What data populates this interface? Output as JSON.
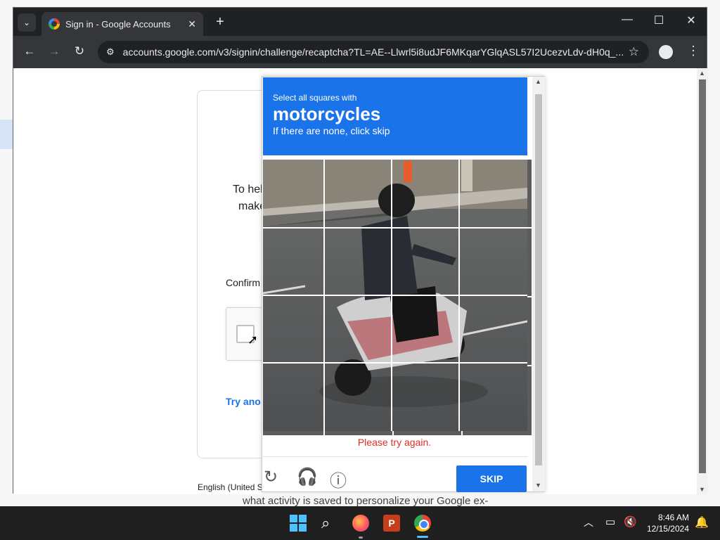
{
  "browser": {
    "tab_title": "Sign in - Google Accounts",
    "url": "accounts.google.com/v3/signin/challenge/recaptcha?TL=AE--Llwrl5i8udJF6MKqarYGlqASL57I2UcezvLdv-dH0q_...",
    "new_tab": "+",
    "tab_close": "✕"
  },
  "signin": {
    "help_line1": "To hel",
    "help_line2": "make",
    "confirm": "Confirm",
    "try_another": "Try ano",
    "language": "English (United S"
  },
  "desktop": {
    "bottom_text": "what activity is saved to personalize your Google ex-"
  },
  "challenge": {
    "instruction": "Select all squares with",
    "target": "motorcycles",
    "subtext": "If there are none, click skip",
    "error": "Please try again.",
    "skip_label": "SKIP",
    "grid_rows": 4,
    "grid_cols": 4
  },
  "taskbar": {
    "time": "8:46 AM",
    "date": "12/15/2024",
    "ppt_letter": "P"
  },
  "colors": {
    "accent": "#1a73e8",
    "error": "#d93025"
  }
}
